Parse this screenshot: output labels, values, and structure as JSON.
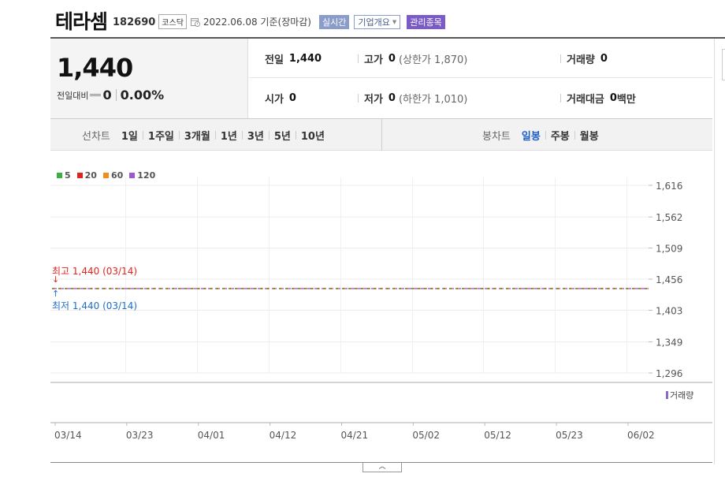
{
  "stock": {
    "name": "테라셈",
    "code": "182690",
    "market": "코스닥",
    "date_text": "2022.06.08 기준(장마감)",
    "realtime_label": "실시간",
    "overview_label": "기업개요",
    "manage_label": "관리종목"
  },
  "price": {
    "current": "1,440",
    "change_label": "전일대비",
    "change_value": "0",
    "change_pct": "0.00%"
  },
  "info": {
    "prev_close": {
      "label": "전일",
      "value": "1,440"
    },
    "high": {
      "label": "고가",
      "value": "0",
      "sub": "(상한가 1,870)"
    },
    "volume": {
      "label": "거래량",
      "value": "0"
    },
    "open": {
      "label": "시가",
      "value": "0"
    },
    "low": {
      "label": "저가",
      "value": "0",
      "sub": "(하한가 1,010)"
    },
    "amount": {
      "label": "거래대금",
      "value": "0",
      "unit": "백만"
    }
  },
  "periods": {
    "title": "선차트",
    "items": [
      "1일",
      "1주일",
      "3개월",
      "1년",
      "3년",
      "5년",
      "10년"
    ]
  },
  "candles": {
    "title": "봉차트",
    "items": [
      "일봉",
      "주봉",
      "월봉"
    ],
    "active": "일봉"
  },
  "legend": [
    {
      "label": "5",
      "color": "#3cb043"
    },
    {
      "label": "20",
      "color": "#e0241c"
    },
    {
      "label": "60",
      "color": "#f28c1e"
    },
    {
      "label": "120",
      "color": "#9b59d0"
    }
  ],
  "annotations": {
    "high": "최고 1,440 (03/14)",
    "low": "최저 1,440 (03/14)",
    "high_arrow": "↓",
    "low_arrow": "↑"
  },
  "volume_label": "거래량",
  "chart_data": {
    "type": "line",
    "x": [
      "03/14",
      "03/23",
      "04/01",
      "04/12",
      "04/21",
      "05/02",
      "05/12",
      "05/23",
      "06/02"
    ],
    "x_tick_labels": [
      "03/14",
      "03/23",
      "04/01",
      "04/12",
      "04/21",
      "05/02",
      "05/12",
      "05/23",
      "06/02"
    ],
    "y_tick_labels": [
      "1,616",
      "1,562",
      "1,509",
      "1,456",
      "1,403",
      "1,349",
      "1,296"
    ],
    "y_ticks": [
      1616,
      1562,
      1509,
      1456,
      1403,
      1349,
      1296
    ],
    "ylim": [
      1296,
      1616
    ],
    "series": [
      {
        "name": "5",
        "color": "#3cb043",
        "values": [
          1440,
          1440,
          1440,
          1440,
          1440,
          1440,
          1440,
          1440,
          1440
        ]
      },
      {
        "name": "20",
        "color": "#e0241c",
        "values": [
          1440,
          1440,
          1440,
          1440,
          1440,
          1440,
          1440,
          1440,
          1440
        ]
      },
      {
        "name": "60",
        "color": "#f28c1e",
        "values": [
          1440,
          1440,
          1440,
          1440,
          1440,
          1440,
          1440,
          1440,
          1440
        ]
      },
      {
        "name": "120",
        "color": "#9b59d0",
        "values": [
          1440,
          1440,
          1440,
          1440,
          1440,
          1440,
          1440,
          1440,
          1440
        ]
      }
    ],
    "grid": true,
    "legend": "top-left"
  }
}
